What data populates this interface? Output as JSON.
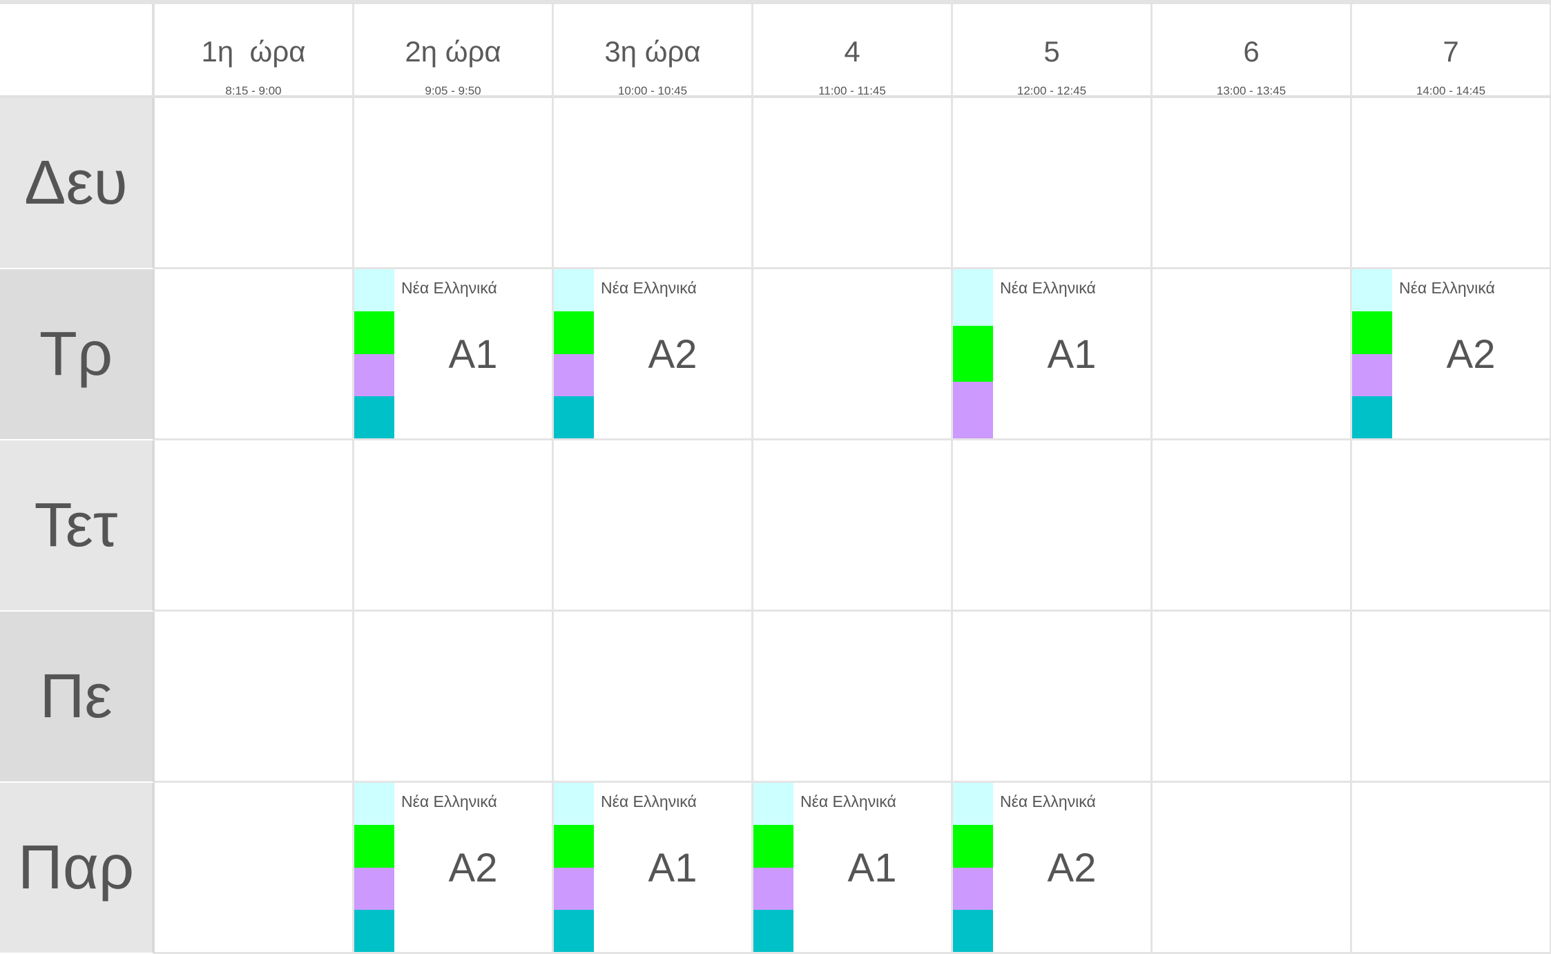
{
  "periods": [
    {
      "name": "1η  ώρα",
      "time": "8:15 - 9:00"
    },
    {
      "name": "2η ώρα",
      "time": "9:05 - 9:50"
    },
    {
      "name": "3η ώρα",
      "time": "10:00 - 10:45"
    },
    {
      "name": "4",
      "time": "11:00 - 11:45"
    },
    {
      "name": "5",
      "time": "12:00 - 12:45"
    },
    {
      "name": "6",
      "time": "13:00 - 13:45"
    },
    {
      "name": "7",
      "time": "14:00 - 14:45"
    }
  ],
  "days": [
    {
      "label": "Δευ",
      "shade": "light",
      "lessons": [
        null,
        null,
        null,
        null,
        null,
        null,
        null
      ]
    },
    {
      "label": "Τρ",
      "shade": "dark",
      "lessons": [
        null,
        {
          "subject": "Νέα Ελληνικά",
          "class": "A1",
          "colors": [
            "#ccffff",
            "#00ff00",
            "#cc99ff",
            "#00c0c8"
          ]
        },
        {
          "subject": "Νέα Ελληνικά",
          "class": "A2",
          "colors": [
            "#ccffff",
            "#00ff00",
            "#cc99ff",
            "#00c0c8"
          ]
        },
        null,
        {
          "subject": "Νέα Ελληνικά",
          "class": "A1",
          "colors": [
            "#ccffff",
            "#00ff00",
            "#cc99ff"
          ]
        },
        null,
        {
          "subject": "Νέα Ελληνικά",
          "class": "A2",
          "colors": [
            "#ccffff",
            "#00ff00",
            "#cc99ff",
            "#00c0c8"
          ]
        }
      ]
    },
    {
      "label": "Τετ",
      "shade": "light",
      "lessons": [
        null,
        null,
        null,
        null,
        null,
        null,
        null
      ]
    },
    {
      "label": "Πε",
      "shade": "dark",
      "lessons": [
        null,
        null,
        null,
        null,
        null,
        null,
        null
      ]
    },
    {
      "label": "Παρ",
      "shade": "light",
      "lessons": [
        null,
        {
          "subject": "Νέα Ελληνικά",
          "class": "A2",
          "colors": [
            "#ccffff",
            "#00ff00",
            "#cc99ff",
            "#00c0c8"
          ]
        },
        {
          "subject": "Νέα Ελληνικά",
          "class": "A1",
          "colors": [
            "#ccffff",
            "#00ff00",
            "#cc99ff",
            "#00c0c8"
          ]
        },
        {
          "subject": "Νέα Ελληνικά",
          "class": "A1",
          "colors": [
            "#ccffff",
            "#00ff00",
            "#cc99ff",
            "#00c0c8"
          ]
        },
        {
          "subject": "Νέα Ελληνικά",
          "class": "A2",
          "colors": [
            "#ccffff",
            "#00ff00",
            "#cc99ff",
            "#00c0c8"
          ]
        },
        null,
        null
      ]
    }
  ]
}
